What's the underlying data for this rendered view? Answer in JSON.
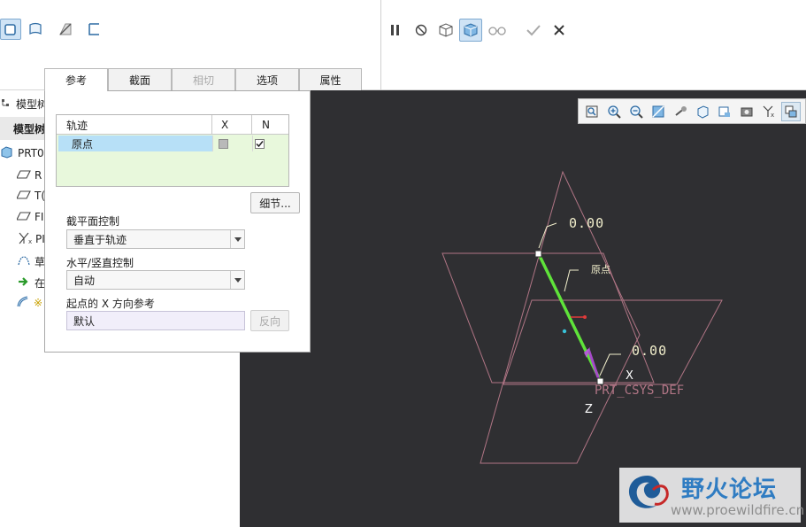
{
  "tabs": [
    {
      "label": "参考",
      "active": true
    },
    {
      "label": "截面"
    },
    {
      "label": "相切",
      "disabled": true
    },
    {
      "label": "选项"
    },
    {
      "label": "属性"
    }
  ],
  "model_tree": {
    "header_title": "模型树",
    "header_label": "模型树",
    "items": [
      {
        "label": "PRT0"
      },
      {
        "label": "R"
      },
      {
        "label": "T("
      },
      {
        "label": "FI"
      },
      {
        "label": "PI"
      },
      {
        "label": "草"
      },
      {
        "label": "在"
      },
      {
        "label": "※"
      }
    ]
  },
  "panel": {
    "table": {
      "columns": [
        "轨迹",
        "X",
        "N"
      ],
      "rows": [
        {
          "name": "原点",
          "x_checked": false,
          "n_checked": true
        }
      ]
    },
    "details_button": "细节...",
    "section_plane_label": "截平面控制",
    "section_plane_value": "垂直于轨迹",
    "hv_control_label": "水平/竖直控制",
    "hv_control_value": "自动",
    "x_dir_label": "起点的 X 方向参考",
    "x_dir_value": "默认",
    "flip_button": "反向"
  },
  "viewport": {
    "dim_top": "0.00",
    "dim_bottom": "0.00",
    "origin_label": "原点",
    "csys_label": "PRT_CSYS_DEF",
    "axis_x": "X",
    "axis_z": "Z"
  },
  "watermark": {
    "title": "野火论坛",
    "url": "www.proewildfire.cn"
  },
  "colors": {
    "viewport_bg": "#2f2f32",
    "datum_planes": "#b07585",
    "trajectory": "#5fe33a",
    "selected_row": "#b7e0f7",
    "table_bg": "#e8f8dc",
    "annotation": "#f2efcc"
  }
}
